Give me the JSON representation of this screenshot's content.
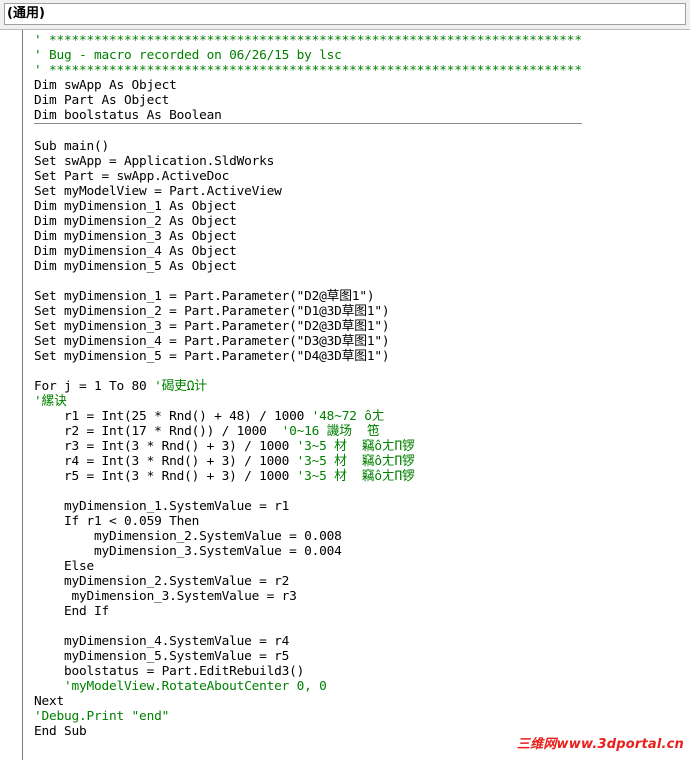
{
  "object_combo": {
    "value": "(通用)"
  },
  "code_lines": [
    {
      "text": "' ***********************************************************************",
      "type": "comment"
    },
    {
      "text": "' Bug - macro recorded on 06/26/15 by lsc",
      "type": "comment"
    },
    {
      "text": "' ***********************************************************************",
      "type": "comment"
    },
    {
      "text": "Dim swApp As Object",
      "type": "code"
    },
    {
      "text": "Dim Part As Object",
      "type": "code"
    },
    {
      "text": "Dim boolstatus As Boolean",
      "type": "code",
      "separator": true
    },
    {
      "text": "",
      "type": "code"
    },
    {
      "text": "Sub main()",
      "type": "code"
    },
    {
      "text": "Set swApp = Application.SldWorks",
      "type": "code"
    },
    {
      "text": "Set Part = swApp.ActiveDoc",
      "type": "code"
    },
    {
      "text": "Set myModelView = Part.ActiveView",
      "type": "code"
    },
    {
      "text": "Dim myDimension_1 As Object",
      "type": "code"
    },
    {
      "text": "Dim myDimension_2 As Object",
      "type": "code"
    },
    {
      "text": "Dim myDimension_3 As Object",
      "type": "code"
    },
    {
      "text": "Dim myDimension_4 As Object",
      "type": "code"
    },
    {
      "text": "Dim myDimension_5 As Object",
      "type": "code"
    },
    {
      "text": "",
      "type": "code"
    },
    {
      "text": "Set myDimension_1 = Part.Parameter(\"D2@草图1\")",
      "type": "code"
    },
    {
      "text": "Set myDimension_2 = Part.Parameter(\"D1@3D草图1\")",
      "type": "code"
    },
    {
      "text": "Set myDimension_3 = Part.Parameter(\"D2@3D草图1\")",
      "type": "code"
    },
    {
      "text": "Set myDimension_4 = Part.Parameter(\"D3@3D草图1\")",
      "type": "code"
    },
    {
      "text": "Set myDimension_5 = Part.Parameter(\"D4@3D草图1\")",
      "type": "code"
    },
    {
      "text": "",
      "type": "code"
    },
    {
      "text": "For j = 1 To 80",
      "type": "code",
      "comment": " '碣吏Ω计"
    },
    {
      "text": "'縲诀",
      "type": "comment"
    },
    {
      "text": "    r1 = Int(25 * Rnd() + 48) / 1000",
      "type": "code",
      "comment": " '48~72 ôㄤ"
    },
    {
      "text": "    r2 = Int(17 * Rnd()) / 1000",
      "type": "code",
      "comment": "  '0~16 譏场  竾"
    },
    {
      "text": "    r3 = Int(3 * Rnd() + 3) / 1000",
      "type": "code",
      "comment": " '3~5 材  竊ôㄤΠ锣"
    },
    {
      "text": "    r4 = Int(3 * Rnd() + 3) / 1000",
      "type": "code",
      "comment": " '3~5 材  竊ôㄤΠ锣"
    },
    {
      "text": "    r5 = Int(3 * Rnd() + 3) / 1000",
      "type": "code",
      "comment": " '3~5 材  竊ôㄤΠ锣"
    },
    {
      "text": "",
      "type": "code"
    },
    {
      "text": "    myDimension_1.SystemValue = r1",
      "type": "code"
    },
    {
      "text": "    If r1 < 0.059 Then",
      "type": "code"
    },
    {
      "text": "        myDimension_2.SystemValue = 0.008",
      "type": "code"
    },
    {
      "text": "        myDimension_3.SystemValue = 0.004",
      "type": "code"
    },
    {
      "text": "    Else",
      "type": "code"
    },
    {
      "text": "    myDimension_2.SystemValue = r2",
      "type": "code"
    },
    {
      "text": "     myDimension_3.SystemValue = r3",
      "type": "code"
    },
    {
      "text": "    End If",
      "type": "code"
    },
    {
      "text": "",
      "type": "code"
    },
    {
      "text": "    myDimension_4.SystemValue = r4",
      "type": "code"
    },
    {
      "text": "    myDimension_5.SystemValue = r5",
      "type": "code"
    },
    {
      "text": "    boolstatus = Part.EditRebuild3()",
      "type": "code"
    },
    {
      "text": "    'myModelView.RotateAboutCenter 0, 0",
      "type": "comment"
    },
    {
      "text": "Next",
      "type": "code"
    },
    {
      "text": "'Debug.Print \"end\"",
      "type": "comment"
    },
    {
      "text": "End Sub",
      "type": "code"
    }
  ],
  "watermark": {
    "text": "三维网www.3dportal.cn"
  },
  "colors": {
    "comment": "#008000",
    "watermark": "#e8211c",
    "background": "#ffffff"
  }
}
